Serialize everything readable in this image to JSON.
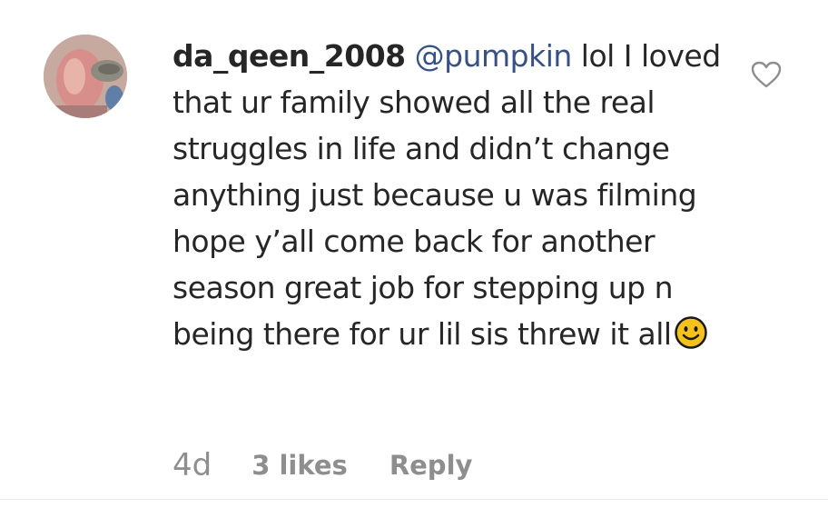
{
  "comment": {
    "username": "da_qeen_2008",
    "mention": "@pumpkin",
    "text": " lol I loved that ur family showed all the real struggles in life and didn’t change anything just because u was filming hope y’all come back for another season great job for stepping up n being there for ur lil sis threw it all",
    "emoji_icon": "smiling-face-icon",
    "time_ago": "4d",
    "likes_label": "3 likes",
    "reply_label": "Reply",
    "like_icon": "heart-outline-icon"
  },
  "colors": {
    "text": "#262626",
    "mention": "#385185",
    "meta": "#8e8e8e",
    "heart_outline": "#8e8e8e",
    "emoji_fill": "#f5c21b"
  }
}
